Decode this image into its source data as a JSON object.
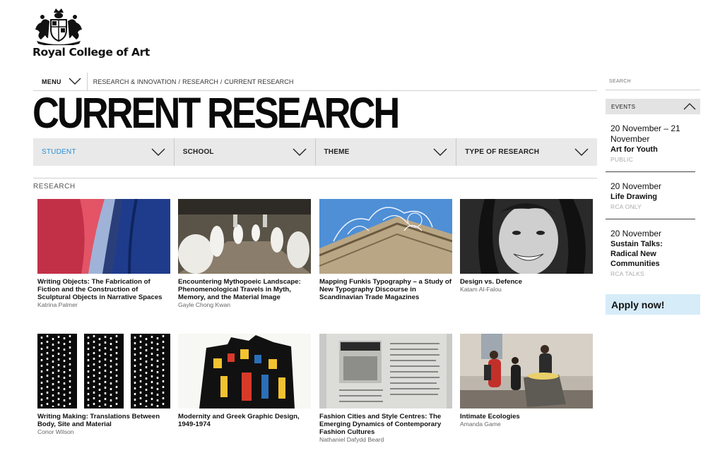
{
  "header": {
    "logo_text": "Royal College of Art",
    "logo_icon": "royal-crest-icon"
  },
  "breadcrumb": {
    "menu_label": "MENU",
    "items": [
      "RESEARCH & INNOVATION",
      "RESEARCH",
      "CURRENT RESEARCH"
    ]
  },
  "page_title": "CURRENT RESEARCH",
  "filters": [
    {
      "label": "STUDENT",
      "active": true
    },
    {
      "label": "SCHOOL",
      "active": false
    },
    {
      "label": "THEME",
      "active": false
    },
    {
      "label": "TYPE OF RESEARCH",
      "active": false
    }
  ],
  "section_label": "RESEARCH",
  "cards": [
    {
      "title": "Writing Objects: The Fabrication of Fiction and the Construction of Sculptural Objects in Narrative Spaces",
      "author": "Katrina Palmer"
    },
    {
      "title": "Encountering Mythopoeic Landscape: Phenomenological Travels in Myth, Memory, and the Material Image",
      "author": "Gayle Chong Kwan"
    },
    {
      "title": "Mapping Funkis Typography – a Study of New Typography Discourse in Scandinavian Trade Magazines",
      "author": ""
    },
    {
      "title": "Design vs. Defence",
      "author": "Katam Al-Falou"
    },
    {
      "title": "Writing Making: Translations Between Body, Site and Material",
      "author": "Conor Wilson"
    },
    {
      "title": "Modernity and Greek Graphic Design, 1949-1974",
      "author": ""
    },
    {
      "title": "Fashion Cities and Style Centres: The Emerging Dynamics of Contemporary Fashion Cultures",
      "author": "Nathaniel Dafydd Beard"
    },
    {
      "title": "Intimate Ecologies",
      "author": "Amanda Game"
    }
  ],
  "sidebar": {
    "search_placeholder": "SEARCH",
    "events_label": "EVENTS",
    "events": [
      {
        "date": "20 November – 21 November",
        "title": "Art for Youth",
        "tag": "PUBLIC"
      },
      {
        "date": "20 November",
        "title": "Life Drawing",
        "tag": "RCA ONLY"
      },
      {
        "date": "20 November",
        "title": "Sustain Talks: Radical New Communities",
        "tag": "RCA TALKS"
      }
    ],
    "apply_label": "Apply now!"
  },
  "colors": {
    "accent_blue": "#2a8fd8",
    "apply_bg": "#d6ecf8",
    "filter_bg": "#e9e9e9"
  }
}
